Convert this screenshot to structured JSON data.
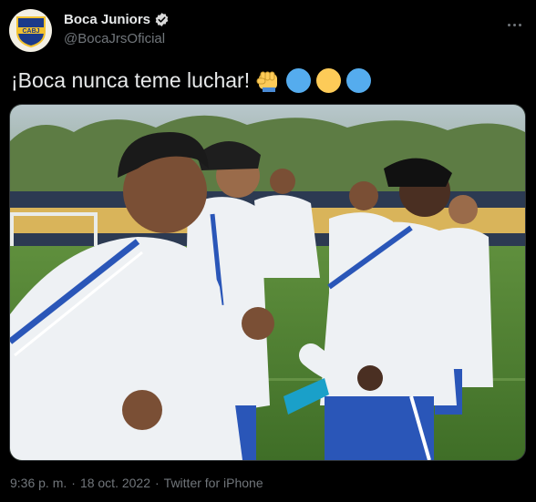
{
  "account": {
    "display_name": "Boca Juniors",
    "handle": "@BocaJrsOficial",
    "avatar_text": "CABJ",
    "verified": true
  },
  "tweet": {
    "text": "¡Boca nunca teme luchar!",
    "emojis": [
      "fist-icon",
      "blue-circle",
      "yellow-circle",
      "blue-circle"
    ]
  },
  "meta": {
    "time": "9:36 p. m.",
    "separator1": "·",
    "date": "18 oct. 2022",
    "separator2": "·",
    "source": "Twitter for iPhone"
  },
  "colors": {
    "background": "#000000",
    "text": "#e7e9ea",
    "muted": "#71767b",
    "blue": "#55acee",
    "yellow": "#fdcb58",
    "boca_blue": "#1b3a8a",
    "boca_gold": "#f2c230"
  }
}
